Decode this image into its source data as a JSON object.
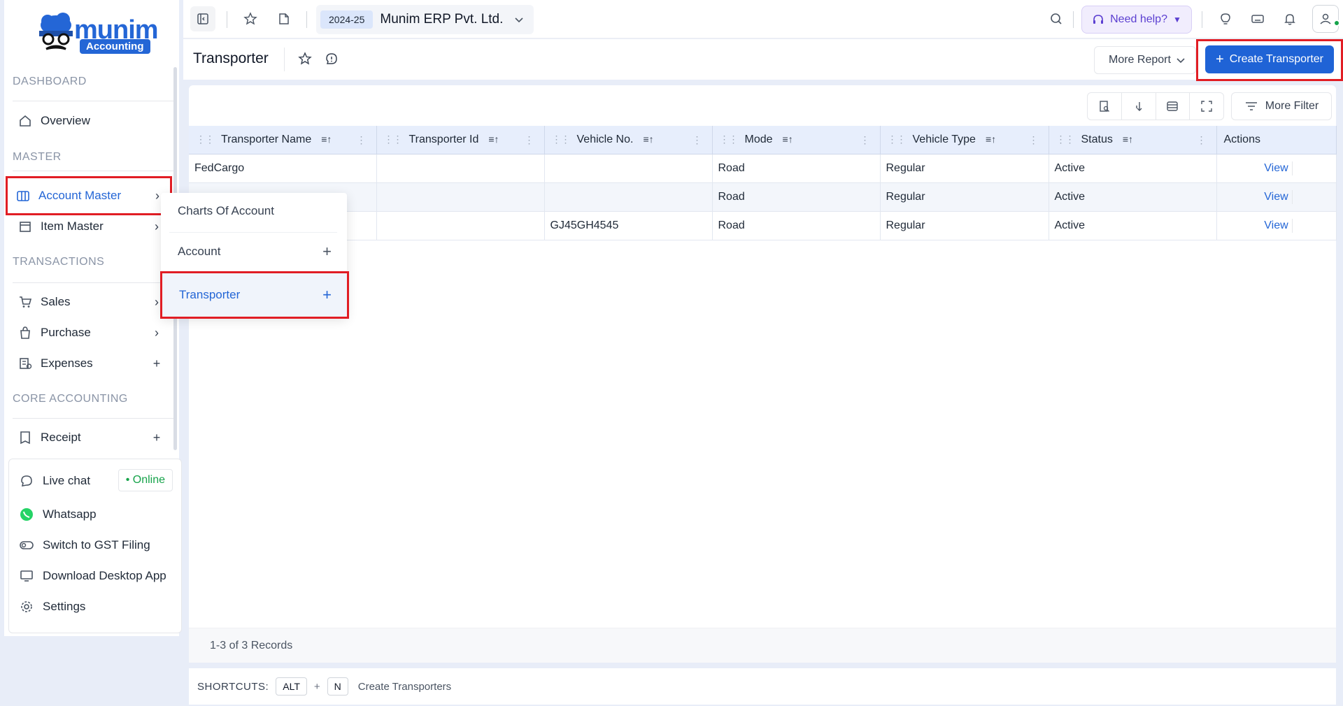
{
  "logo": {
    "name": "munim",
    "badge": "Accounting"
  },
  "sidebar": {
    "sections": [
      "DASHBOARD",
      "MASTER",
      "TRANSACTIONS",
      "CORE ACCOUNTING"
    ],
    "items": {
      "overview": "Overview",
      "account_master": "Account Master",
      "item_master": "Item Master",
      "sales": "Sales",
      "purchase": "Purchase",
      "expenses": "Expenses",
      "receipt": "Receipt"
    },
    "bottom": {
      "live_chat": "Live chat",
      "online": "• Online",
      "whatsapp": "Whatsapp",
      "gst": "Switch to GST Filing",
      "download": "Download Desktop App",
      "settings": "Settings"
    }
  },
  "submenu": {
    "charts": "Charts Of Account",
    "account": "Account",
    "transporter": "Transporter"
  },
  "topbar": {
    "year": "2024-25",
    "company": "Munim ERP Pvt. Ltd.",
    "help": "Need help?"
  },
  "page": {
    "title": "Transporter",
    "more_report": "More Report",
    "create": "Create Transporter",
    "more_filter": "More Filter"
  },
  "table": {
    "columns": [
      "Transporter Name",
      "Transporter Id",
      "Vehicle No.",
      "Mode",
      "Vehicle Type",
      "Status",
      "Actions"
    ],
    "rows": [
      {
        "name": "FedCargo",
        "id": "",
        "vehicle": "",
        "mode": "Road",
        "type": "Regular",
        "status": "Active",
        "action": "View"
      },
      {
        "name": "",
        "id": "",
        "vehicle": "",
        "mode": "Road",
        "type": "Regular",
        "status": "Active",
        "action": "View"
      },
      {
        "name": "",
        "id": "",
        "vehicle": "GJ45GH4545",
        "mode": "Road",
        "type": "Regular",
        "status": "Active",
        "action": "View"
      }
    ],
    "records": "1-3 of 3 Records"
  },
  "shortcuts": {
    "label": "SHORTCUTS:",
    "key1": "ALT",
    "plus": "+",
    "key2": "N",
    "desc": "Create Transporters"
  },
  "colors": {
    "accent": "#2466d6",
    "highlight": "#e11d24",
    "online": "#16a34a"
  }
}
